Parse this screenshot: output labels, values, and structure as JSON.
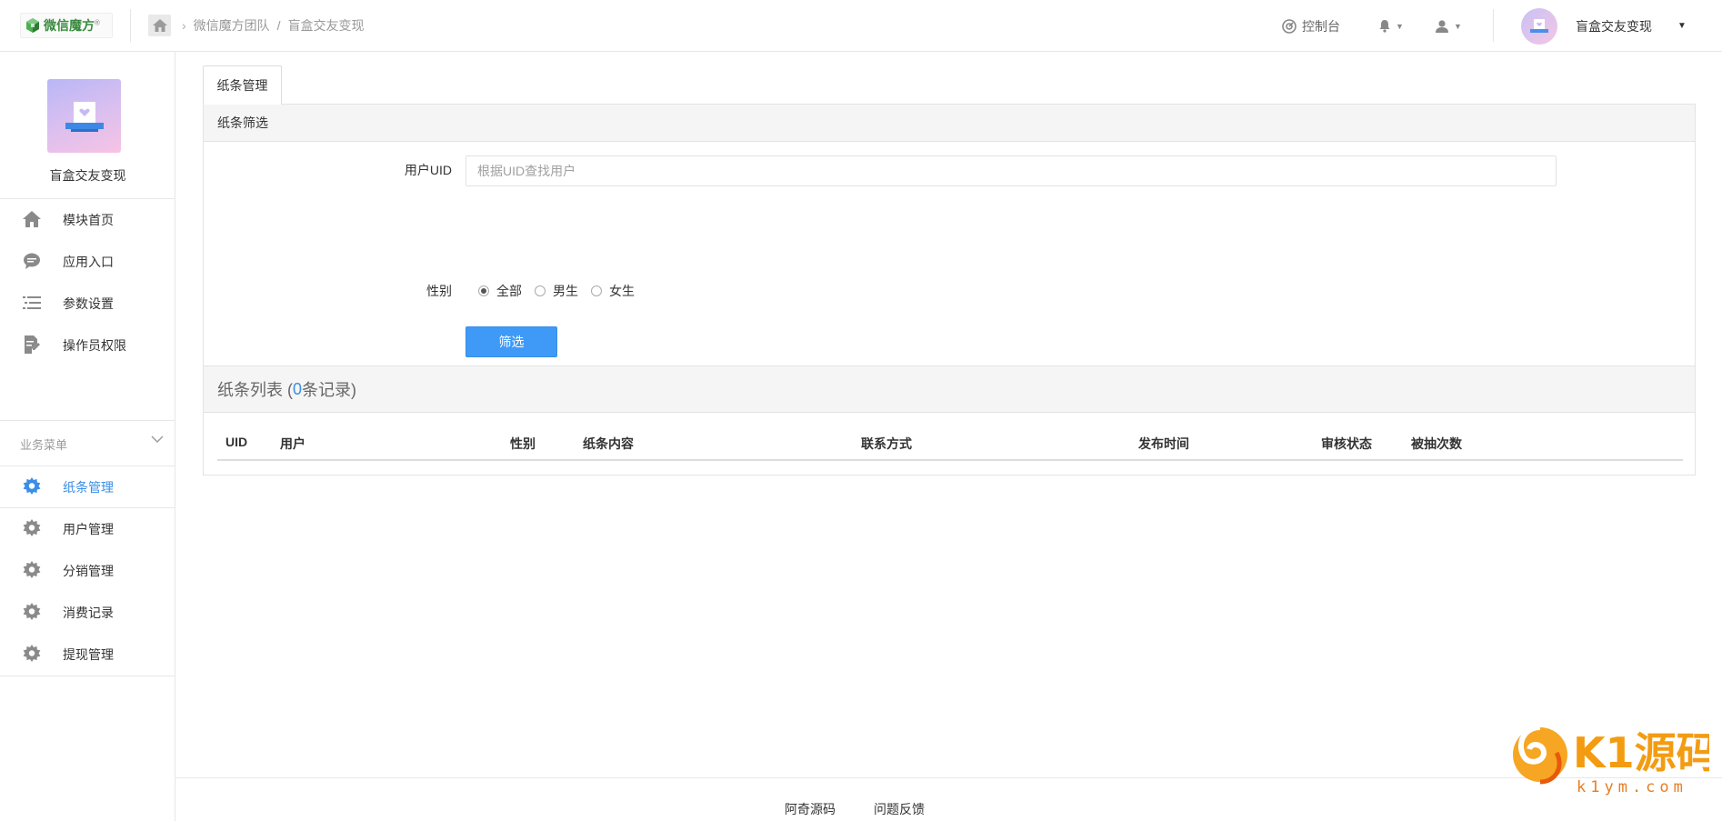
{
  "header": {
    "logo_text": "微信魔方",
    "logo_mark": "®",
    "breadcrumb": [
      "微信魔方团队",
      "/",
      "盲盒交友变现"
    ],
    "console_label": "控制台",
    "user_name": "盲盒交友变现"
  },
  "sidebar": {
    "app_name": "盲盒交友变现",
    "items": [
      {
        "label": "模块首页",
        "icon": "home-icon"
      },
      {
        "label": "应用入口",
        "icon": "chat-bubble-icon"
      },
      {
        "label": "参数设置",
        "icon": "list-icon"
      },
      {
        "label": "操作员权限",
        "icon": "edit-document-icon"
      }
    ],
    "section_title": "业务菜单",
    "business_items": [
      {
        "label": "纸条管理",
        "icon": "gear-icon",
        "active": true
      },
      {
        "label": "用户管理",
        "icon": "gear-icon"
      },
      {
        "label": "分销管理",
        "icon": "gear-icon"
      },
      {
        "label": "消费记录",
        "icon": "gear-icon"
      },
      {
        "label": "提现管理",
        "icon": "gear-icon"
      }
    ]
  },
  "main": {
    "tab_label": "纸条管理",
    "filter": {
      "title": "纸条筛选",
      "uid_label": "用户UID",
      "uid_placeholder": "根据UID查找用户",
      "uid_value": "",
      "gender_label": "性别",
      "gender_options": [
        "全部",
        "男生",
        "女生"
      ],
      "gender_selected": "全部",
      "submit_label": "筛选"
    },
    "list": {
      "title_prefix": "纸条列表 (",
      "count": "0",
      "title_suffix": "条记录)",
      "columns": [
        "UID",
        "用户",
        "性别",
        "纸条内容",
        "联系方式",
        "发布时间",
        "审核状态",
        "被抽次数"
      ],
      "rows": []
    }
  },
  "footer": {
    "links": [
      "阿奇源码",
      "问题反馈"
    ]
  },
  "watermark": {
    "brand": "K1源码",
    "domain": "k1ym.com"
  },
  "colors": {
    "accent": "#3f9af7",
    "active_text": "#3a8ee6",
    "logo_green": "#3a8c3f"
  }
}
